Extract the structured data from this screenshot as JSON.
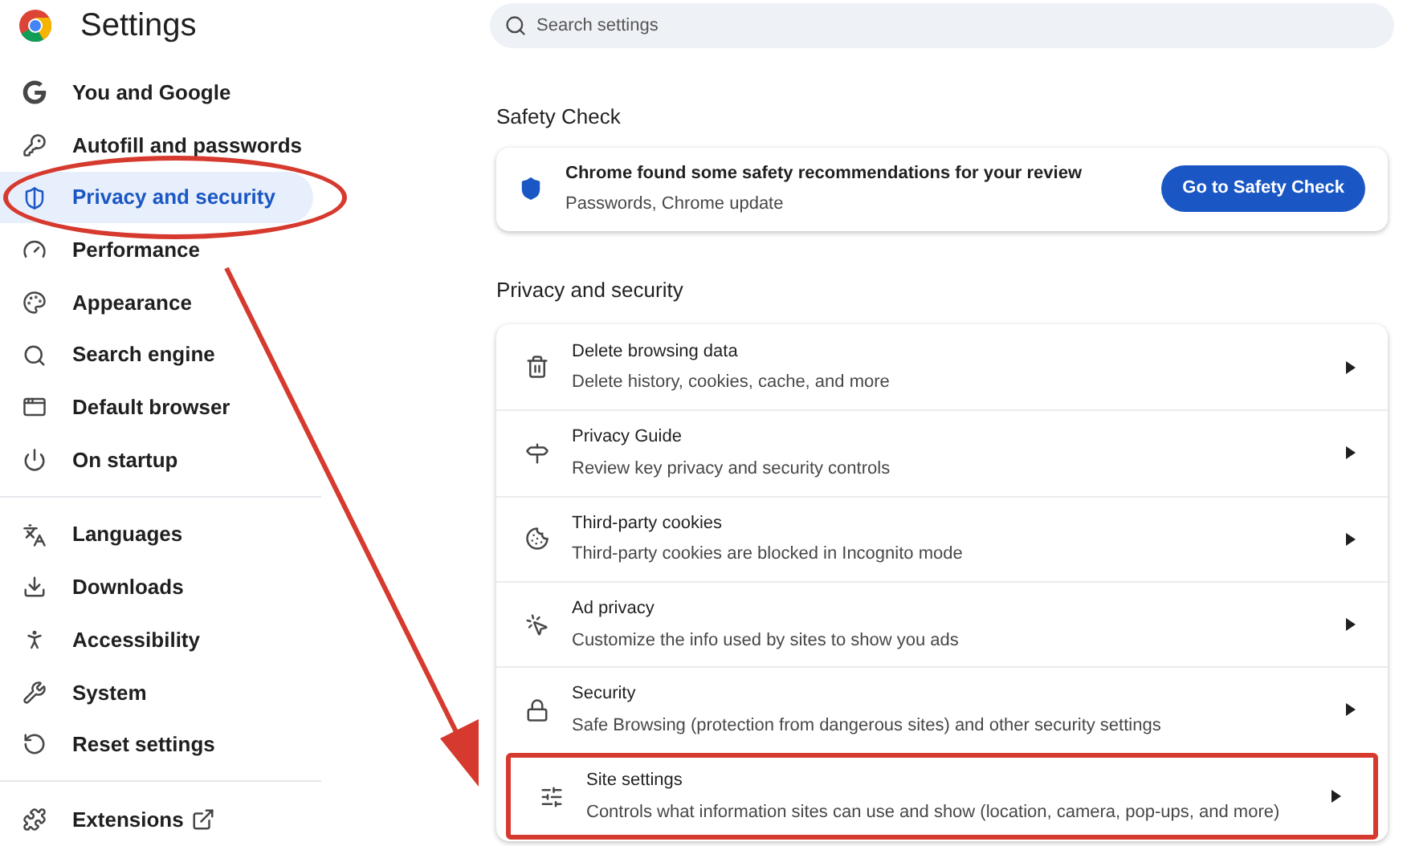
{
  "header": {
    "title": "Settings"
  },
  "search": {
    "placeholder": "Search settings"
  },
  "sidebar": {
    "groups": [
      [
        {
          "label": "You and Google",
          "selected": false,
          "annotated": false
        },
        {
          "label": "Autofill and passwords",
          "selected": false,
          "annotated": false
        },
        {
          "label": "Privacy and security",
          "selected": true,
          "annotated": true
        },
        {
          "label": "Performance",
          "selected": false,
          "annotated": false
        },
        {
          "label": "Appearance",
          "selected": false,
          "annotated": false
        },
        {
          "label": "Search engine",
          "selected": false,
          "annotated": false
        },
        {
          "label": "Default browser",
          "selected": false,
          "annotated": false
        },
        {
          "label": "On startup",
          "selected": false,
          "annotated": false
        }
      ],
      [
        {
          "label": "Languages",
          "selected": false,
          "annotated": false
        },
        {
          "label": "Downloads",
          "selected": false,
          "annotated": false
        },
        {
          "label": "Accessibility",
          "selected": false,
          "annotated": false
        },
        {
          "label": "System",
          "selected": false,
          "annotated": false
        },
        {
          "label": "Reset settings",
          "selected": false,
          "annotated": false
        }
      ],
      [
        {
          "label": "Extensions",
          "selected": false,
          "annotated": false,
          "external": true
        }
      ]
    ]
  },
  "safety_check": {
    "heading": "Safety Check",
    "title": "Chrome found some safety recommendations for your review",
    "subtitle": "Passwords, Chrome update",
    "button": "Go to Safety Check"
  },
  "privacy": {
    "heading": "Privacy and security",
    "rows": [
      {
        "title": "Delete browsing data",
        "subtitle": "Delete history, cookies, cache, and more",
        "annotated": false
      },
      {
        "title": "Privacy Guide",
        "subtitle": "Review key privacy and security controls",
        "annotated": false
      },
      {
        "title": "Third-party cookies",
        "subtitle": "Third-party cookies are blocked in Incognito mode",
        "annotated": false
      },
      {
        "title": "Ad privacy",
        "subtitle": "Customize the info used by sites to show you ads",
        "annotated": false
      },
      {
        "title": "Security",
        "subtitle": "Safe Browsing (protection from dangerous sites) and other security settings",
        "annotated": false
      },
      {
        "title": "Site settings",
        "subtitle": "Controls what information sites can use and show (location, camera, pop-ups, and more)",
        "annotated": true
      }
    ]
  }
}
